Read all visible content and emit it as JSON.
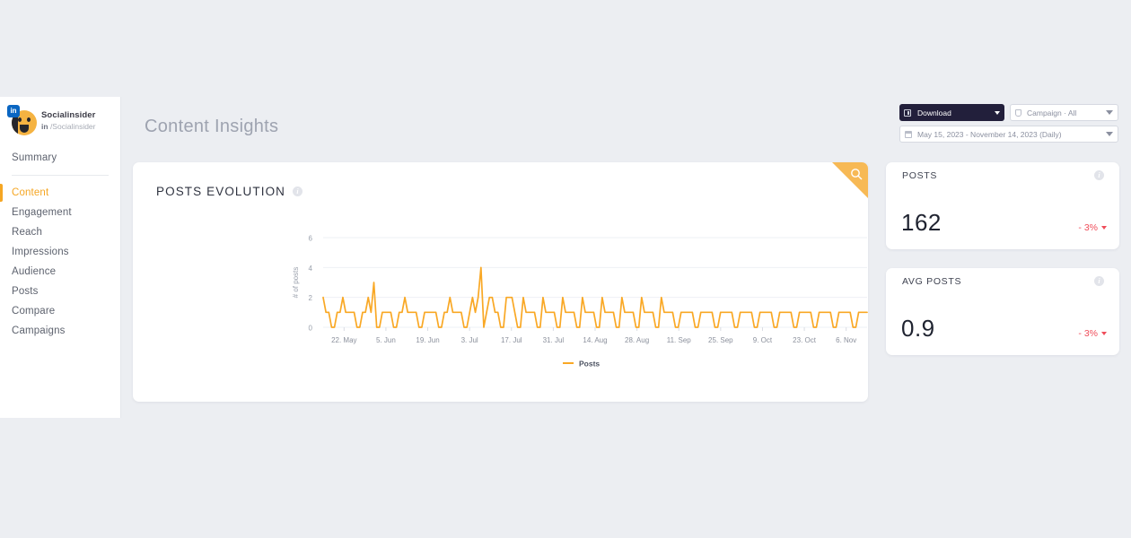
{
  "page": {
    "title": "Content Insights"
  },
  "sidebar": {
    "brand": {
      "name": "Socialinsider",
      "network": "in",
      "handle": "/Socialinsider",
      "avatar_icon": "face-avatar",
      "badge_icon": "linkedin-badge-icon"
    },
    "items": [
      {
        "label": "Summary",
        "active": false
      },
      {
        "label": "Content",
        "active": true
      },
      {
        "label": "Engagement",
        "active": false
      },
      {
        "label": "Reach",
        "active": false
      },
      {
        "label": "Impressions",
        "active": false
      },
      {
        "label": "Audience",
        "active": false
      },
      {
        "label": "Posts",
        "active": false
      },
      {
        "label": "Compare",
        "active": false
      },
      {
        "label": "Campaigns",
        "active": false
      }
    ]
  },
  "toolbar": {
    "download_label": "Download",
    "download_icon": "download-icon",
    "campaign_label": "Campaign · All",
    "campaign_icon": "tag-icon",
    "date_label": "May 15, 2023 - November 14, 2023 (Daily)",
    "date_icon": "calendar-icon",
    "caret_icon": "chevron-down-icon"
  },
  "chart_card": {
    "title": "POSTS EVOLUTION",
    "info_icon": "info-icon",
    "expand_icon": "magnifier-icon"
  },
  "kpis": [
    {
      "label": "POSTS",
      "value": "162",
      "delta": "- 3%",
      "delta_color": "#ef4d5a",
      "info_icon": "info-icon"
    },
    {
      "label": "AVG POSTS",
      "value": "0.9",
      "delta": "- 3%",
      "delta_color": "#ef4d5a",
      "info_icon": "info-icon"
    }
  ],
  "colors": {
    "accent": "#f5a623",
    "series": "#f9a825",
    "negative": "#ef4d5a",
    "dark": "#221f3b",
    "page_bg": "#eceef2"
  },
  "chart_data": {
    "type": "line",
    "title": "POSTS EVOLUTION",
    "xlabel": "",
    "ylabel": "# of posts",
    "ylim": [
      0,
      6
    ],
    "yticks": [
      0,
      2,
      4,
      6
    ],
    "grid": true,
    "legend_position": "bottom",
    "series": [
      {
        "name": "Posts",
        "color": "#f9a825",
        "values": [
          2,
          1,
          1,
          0,
          0,
          1,
          1,
          2,
          1,
          1,
          1,
          1,
          0,
          0,
          1,
          1,
          2,
          1,
          3,
          0,
          0,
          1,
          1,
          1,
          1,
          0,
          0,
          1,
          1,
          2,
          1,
          1,
          1,
          1,
          0,
          0,
          1,
          1,
          1,
          1,
          1,
          0,
          0,
          1,
          1,
          2,
          1,
          1,
          1,
          1,
          0,
          0,
          1,
          2,
          1,
          2,
          4,
          0,
          1,
          2,
          2,
          1,
          1,
          0,
          0,
          2,
          2,
          2,
          1,
          0,
          0,
          2,
          1,
          1,
          1,
          1,
          0,
          0,
          2,
          1,
          1,
          1,
          1,
          0,
          0,
          2,
          1,
          1,
          1,
          1,
          0,
          0,
          2,
          1,
          1,
          1,
          1,
          0,
          0,
          2,
          1,
          1,
          1,
          1,
          0,
          0,
          2,
          1,
          1,
          1,
          1,
          0,
          0,
          2,
          1,
          1,
          1,
          1,
          0,
          0,
          2,
          1,
          1,
          1,
          1,
          0,
          0,
          1,
          1,
          1,
          1,
          1,
          0,
          0,
          1,
          1,
          1,
          1,
          1,
          0,
          0,
          1,
          1,
          1,
          1,
          1,
          0,
          0,
          1,
          1,
          1,
          1,
          1,
          0,
          0,
          1,
          1,
          1,
          1,
          1,
          0,
          0,
          1,
          1,
          1,
          1,
          1,
          0,
          0,
          1,
          1,
          1,
          1,
          1,
          0,
          0,
          1,
          1,
          1,
          1,
          1,
          0,
          0,
          1,
          1,
          1,
          1,
          1,
          0,
          0,
          1,
          1,
          1,
          1
        ]
      }
    ],
    "xticks": [
      "22. May",
      "5. Jun",
      "19. Jun",
      "3. Jul",
      "17. Jul",
      "31. Jul",
      "14. Aug",
      "28. Aug",
      "11. Sep",
      "25. Sep",
      "9. Oct",
      "23. Oct",
      "6. Nov"
    ],
    "legend": [
      {
        "label": "Posts",
        "color": "#f9a825"
      }
    ]
  }
}
